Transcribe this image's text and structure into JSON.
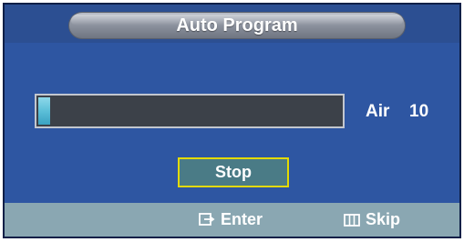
{
  "window": {
    "title": "Auto Program"
  },
  "scan": {
    "progress_fraction": 0.04,
    "channel_type": "Air",
    "channel_number": "10"
  },
  "buttons": {
    "stop_label": "Stop"
  },
  "footer": {
    "enter_label": "Enter",
    "enter_icon": "enter-icon",
    "skip_label": "Skip",
    "skip_icon": "skip-icon"
  },
  "colors": {
    "panel": "#2e56a2",
    "footer": "#8aa7b2",
    "progress_fill": "#5cbfd8",
    "focus_border": "#e3da00"
  }
}
